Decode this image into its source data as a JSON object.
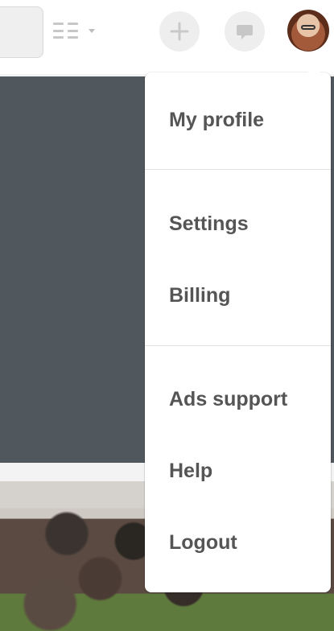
{
  "header": {
    "buttons": {
      "plus_label": "+",
      "chat_label": ""
    },
    "icons": {
      "view": "grid-list-icon",
      "plus": "plus-icon",
      "chat": "chat-bubble-icon",
      "avatar": "avatar-photo"
    }
  },
  "menu": {
    "items": [
      {
        "label": "My profile"
      },
      {
        "label": "Settings"
      },
      {
        "label": "Billing"
      },
      {
        "label": "Ads support"
      },
      {
        "label": "Help"
      },
      {
        "label": "Logout"
      }
    ]
  },
  "colors": {
    "header_bg": "#ffffff",
    "backdrop": "#50575d",
    "menu_bg": "#ffffff",
    "menu_text": "#555555",
    "icon_gray": "#c7c7c7",
    "button_bg": "#eeeeee"
  }
}
